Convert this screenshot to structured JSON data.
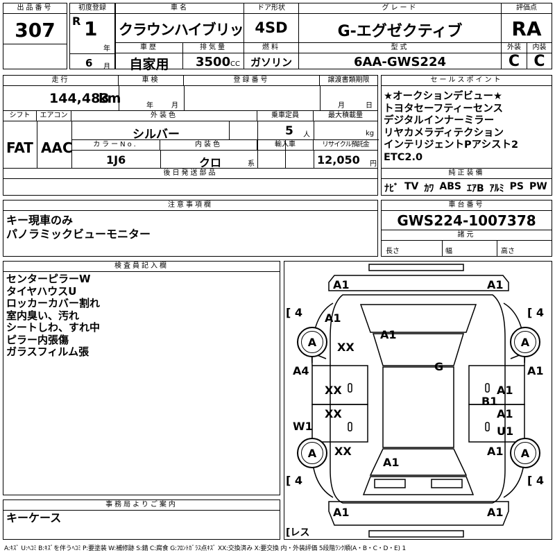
{
  "header": {
    "lot_label": "出品番号",
    "lot": "307",
    "first_reg_label": "初度登録",
    "era": "R",
    "year": "1",
    "year_unit": "年",
    "month": "6",
    "month_unit": "月",
    "car_name_label": "車名",
    "car_name": "クラウンハイブリッド",
    "door_label": "ドア形状",
    "door": "4SD",
    "grade_label": "グレード",
    "grade": "G-エグゼクティブ",
    "score_label": "評価点",
    "score": "RA",
    "history_label": "車歴",
    "history": "自家用",
    "displacement_label": "排気量",
    "displacement": "3500",
    "displacement_unit": "CC",
    "fuel_label": "燃料",
    "fuel": "ガソリン",
    "model_label": "型式",
    "model": "6AA-GWS224",
    "exterior_label": "外装",
    "exterior": "C",
    "interior_label": "内装",
    "interior": "C"
  },
  "row2": {
    "mileage_label": "走行",
    "mileage": "144,483",
    "mileage_unit": "km",
    "inspection_label": "車検",
    "insp_year_unit": "年",
    "insp_month_unit": "月",
    "reg_no_label": "登録番号",
    "transfer_label": "譲渡書類期限",
    "transfer_month_unit": "月",
    "transfer_day_unit": "日",
    "shift_label": "シフト",
    "shift": "FAT",
    "ac_label": "エアコン",
    "ac": "AAC",
    "color_label": "外装色",
    "color": "シルバー",
    "capacity_label": "乗車定員",
    "capacity": "5",
    "capacity_unit": "人",
    "load_label": "最大積載量",
    "load_unit": "kg",
    "color_no_label": "カラーNo.",
    "color_no": "1J6",
    "int_color_label": "内装色",
    "int_color": "クロ",
    "int_color_unit": "系",
    "import_label": "輸入車",
    "recycle_label": "リサイクル預託金",
    "recycle": "12,050",
    "recycle_unit": "円",
    "later_parts_label": "後日発送部品"
  },
  "sales_points": {
    "label": "セールスポイント",
    "items": [
      "★オークションデビュー★",
      "トヨタセーフティーセンス",
      "デジタルインナーミラー",
      "リヤカメラディテクション",
      "インテリジェントPアシスト2",
      "ETC2.0"
    ]
  },
  "equipment": {
    "label": "純正装備",
    "items": [
      "ﾅﾋﾞ",
      "TV",
      "ｶﾜ",
      "ABS",
      "ｴｱB",
      "ｱﾙﾐ",
      "PS",
      "PW"
    ]
  },
  "notes": {
    "label": "注意事項欄",
    "items": [
      "キー現車のみ",
      "パノラミックビューモニター"
    ]
  },
  "chassis": {
    "label": "車台番号",
    "number": "GWS224-1007378",
    "spec_label": "諸元",
    "length_label": "長さ",
    "width_label": "幅",
    "height_label": "高さ"
  },
  "inspector": {
    "label": "検査員記入欄",
    "items": [
      "センターピラーW",
      "タイヤハウスU",
      "ロッカーカバー割れ",
      "室内臭い、汚れ",
      "シートしわ、すれ中",
      "ピラー内張傷",
      "ガラスフィルム張"
    ]
  },
  "office": {
    "label": "事務局よりご案内",
    "items": [
      "キーケース"
    ]
  },
  "diagram": {
    "marks": [
      "A1",
      "A1",
      "A1",
      "XX",
      "A1",
      "G",
      "A4",
      "A1",
      "XX",
      "A1",
      "B1",
      "XX",
      "A1",
      "W1",
      "U1",
      "XX",
      "A1",
      "A1",
      "A1",
      "A1"
    ],
    "tire_labels": [
      "A",
      "A",
      "A",
      "A"
    ],
    "tread": [
      "[ 4",
      "[ 4",
      "[ 4",
      "[ 4"
    ],
    "spare": "[レス"
  },
  "legend": "A:ｷｽﾞ U:ﾍｺﾐ B:ｷｽﾞを伴うﾍｺﾐ P:要塗装 W:補修跡 S:錆 C:腐食 G:ﾌﾛﾝﾄｶﾞﾗｽ点ｷｽﾞ XX:交換済み X:要交換 内・外装評価 5段階ﾗﾝｸ順(A・B・C・D・E) 1"
}
